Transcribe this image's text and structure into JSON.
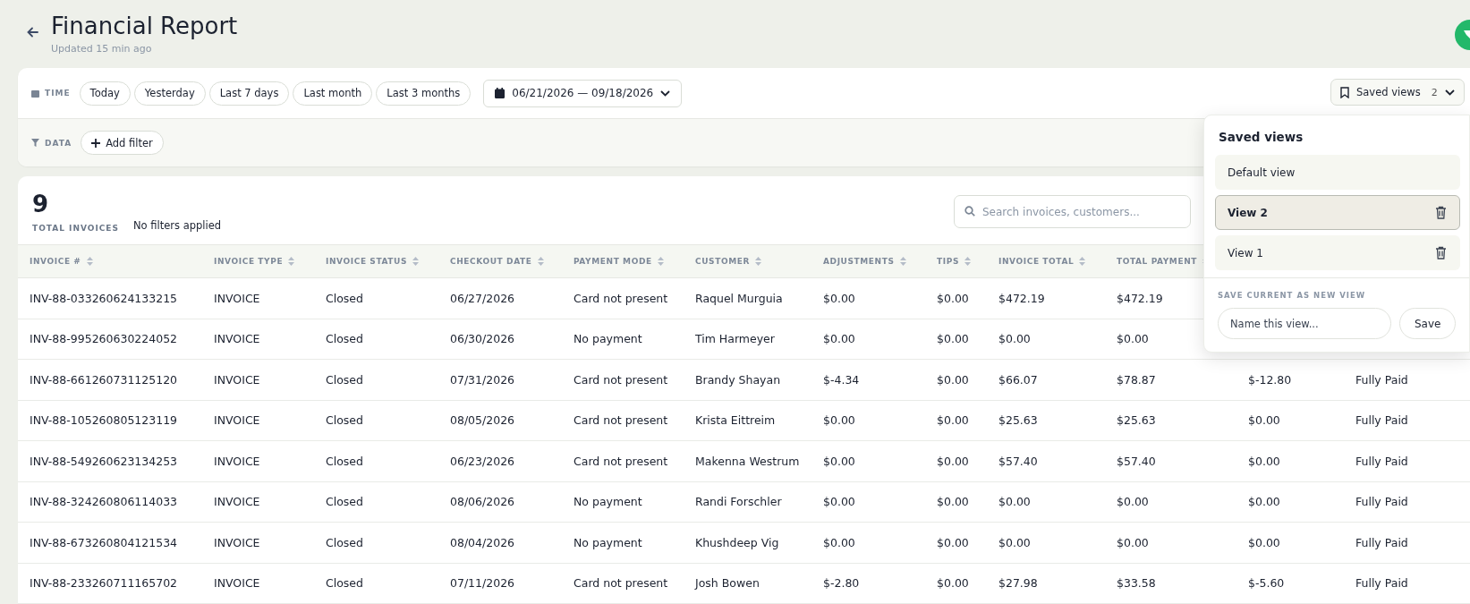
{
  "header": {
    "title": "Financial Report",
    "subtitle": "Updated 15 min ago"
  },
  "time_filter": {
    "label": "TIME",
    "presets": [
      {
        "label": "Today",
        "selected": false
      },
      {
        "label": "Yesterday",
        "selected": false
      },
      {
        "label": "Last 7 days",
        "selected": false
      },
      {
        "label": "Last month",
        "selected": false
      },
      {
        "label": "Last 3 months",
        "selected": false
      }
    ],
    "date_range": "06/21/2026 — 09/18/2026"
  },
  "saved_views_button": {
    "label": "Saved views",
    "count": "2"
  },
  "data_filter": {
    "label": "DATA",
    "add_button": "Add filter"
  },
  "summary": {
    "count": "9",
    "count_label": "TOTAL INVOICES",
    "filters_note": "No filters applied"
  },
  "search": {
    "placeholder": "Search invoices, customers..."
  },
  "table": {
    "columns": [
      "INVOICE #",
      "INVOICE TYPE",
      "INVOICE STATUS",
      "CHECKOUT DATE",
      "PAYMENT MODE",
      "CUSTOMER",
      "ADJUSTMENTS",
      "TIPS",
      "INVOICE TOTAL",
      "TOTAL PAYMENT"
    ],
    "rows": [
      {
        "cells": [
          "INV-88-033260624133215",
          "INVOICE",
          "Closed",
          "06/27/2026",
          "Card not present",
          "Raquel Murguia",
          "$0.00",
          "$0.00",
          "$472.19",
          "$472.19"
        ]
      },
      {
        "cells": [
          "INV-88-995260630224052",
          "INVOICE",
          "Closed",
          "06/30/2026",
          "No payment",
          "Tim Harmeyer",
          "$0.00",
          "$0.00",
          "$0.00",
          "$0.00"
        ]
      },
      {
        "cells": [
          "INV-88-661260731125120",
          "INVOICE",
          "Closed",
          "07/31/2026",
          "Card not present",
          "Brandy Shayan",
          "$-4.34",
          "$0.00",
          "$66.07",
          "$78.87",
          "$-12.80",
          "Fully Paid"
        ]
      },
      {
        "cells": [
          "INV-88-105260805123119",
          "INVOICE",
          "Closed",
          "08/05/2026",
          "Card not present",
          "Krista Eittreim",
          "$0.00",
          "$0.00",
          "$25.63",
          "$25.63",
          "$0.00",
          "Fully Paid"
        ]
      },
      {
        "cells": [
          "INV-88-549260623134253",
          "INVOICE",
          "Closed",
          "06/23/2026",
          "Card not present",
          "Makenna Westrum",
          "$0.00",
          "$0.00",
          "$57.40",
          "$57.40",
          "$0.00",
          "Fully Paid"
        ]
      },
      {
        "cells": [
          "INV-88-324260806114033",
          "INVOICE",
          "Closed",
          "08/06/2026",
          "No payment",
          "Randi Forschler",
          "$0.00",
          "$0.00",
          "$0.00",
          "$0.00",
          "$0.00",
          "Fully Paid"
        ]
      },
      {
        "cells": [
          "INV-88-673260804121534",
          "INVOICE",
          "Closed",
          "08/04/2026",
          "No payment",
          "Khushdeep Vig",
          "$0.00",
          "$0.00",
          "$0.00",
          "$0.00",
          "$0.00",
          "Fully Paid"
        ]
      },
      {
        "cells": [
          "INV-88-233260711165702",
          "INVOICE",
          "Closed",
          "07/11/2026",
          "Card not present",
          "Josh Bowen",
          "$-2.80",
          "$0.00",
          "$27.98",
          "$33.58",
          "$-5.60",
          "Fully Paid"
        ]
      }
    ]
  },
  "saved_views_popup": {
    "title": "Saved views",
    "views": [
      {
        "label": "Default view",
        "selected": false,
        "deletable": false
      },
      {
        "label": "View 2",
        "selected": true,
        "deletable": true
      },
      {
        "label": "View 1",
        "selected": false,
        "deletable": true
      }
    ],
    "save_label": "SAVE CURRENT AS NEW VIEW",
    "name_placeholder": "Name this view...",
    "save_button": "Save"
  }
}
